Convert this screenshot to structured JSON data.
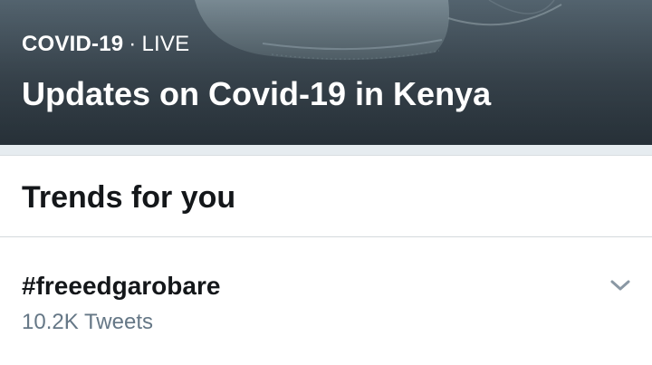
{
  "hero": {
    "category": "COVID-19",
    "separator": "·",
    "status": "LIVE",
    "title": "Updates on Covid-19 in Kenya"
  },
  "trends": {
    "heading": "Trends for you",
    "items": [
      {
        "name": "#freeedgarobare",
        "count": "10.2K Tweets",
        "menu_icon": "chevron-down-icon"
      }
    ]
  },
  "colors": {
    "text_primary": "#14171a",
    "text_secondary": "#657786",
    "divider": "#e6ecf0"
  }
}
